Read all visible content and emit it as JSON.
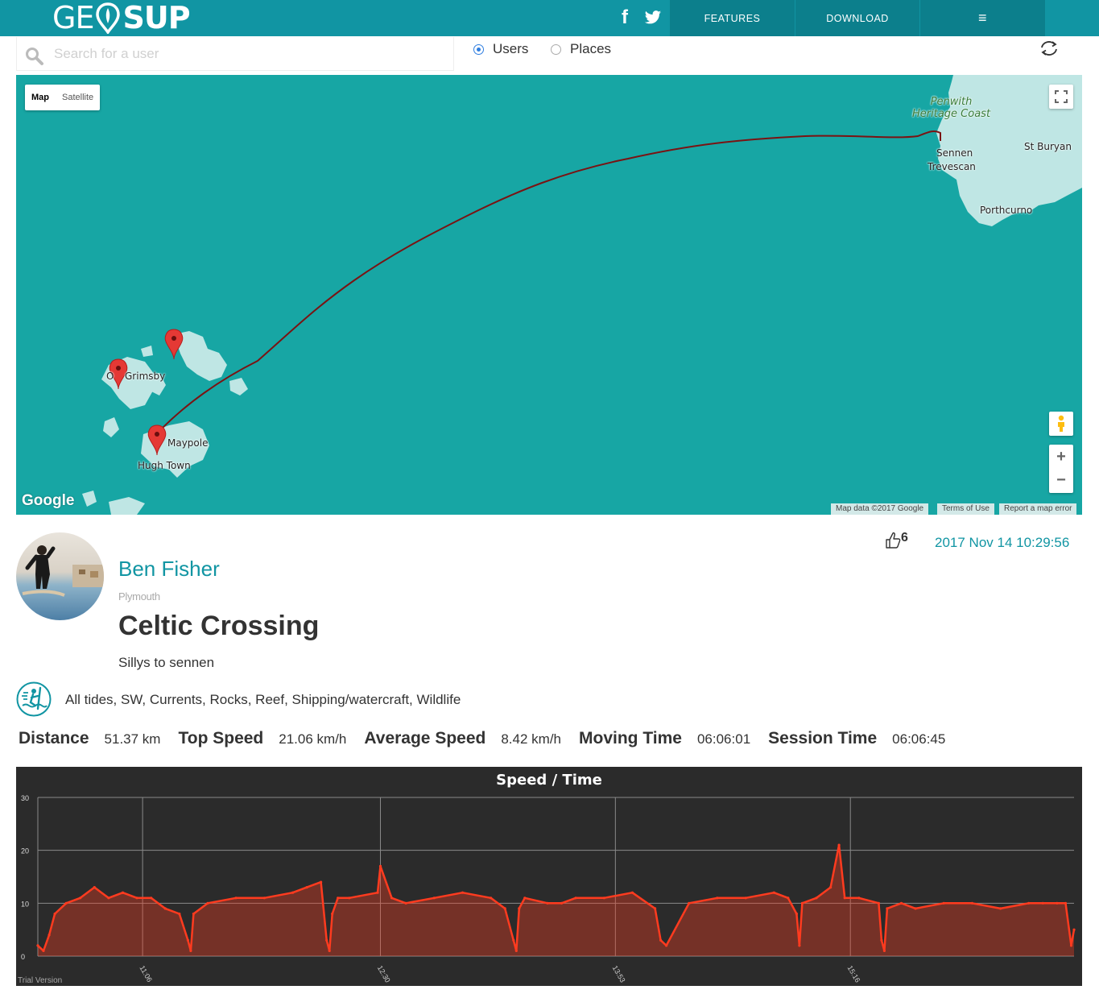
{
  "brand": {
    "logo_left": "GE",
    "logo_right": "SUP"
  },
  "nav": {
    "features": "FEATURES",
    "download": "DOWNLOAD",
    "menu": "≡",
    "facebook": "f"
  },
  "search": {
    "placeholder": "Search for a user",
    "value": ""
  },
  "filter": {
    "options": [
      "Users",
      "Places"
    ],
    "selected": "Users"
  },
  "map": {
    "type_buttons": [
      "Map",
      "Satellite"
    ],
    "selected_type": "Map",
    "labels": {
      "penwith": "Penwith\nHeritage Coast",
      "sennen": "Sennen",
      "trevescan": "Trevescan",
      "st_buryan": "St Buryan",
      "porthcurno": "Porthcurno",
      "grimsby": "Grimsby",
      "maypole": "Maypole",
      "hugh_town": "Hugh Town",
      "old_grimsby_prefix": "O"
    },
    "google_logo": "Google",
    "attribution": {
      "data": "Map data ©2017 Google",
      "terms": "Terms of Use",
      "report": "Report a map error"
    },
    "zoom_in": "+",
    "zoom_out": "−",
    "colors": {
      "water": "#17a6a4",
      "land": "#bfe6e4",
      "track": "#7a1313",
      "marker": "#e53935"
    }
  },
  "session": {
    "user_name": "Ben Fisher",
    "user_city": "Plymouth",
    "title": "Celtic Crossing",
    "description": "Sillys to sennen",
    "likes": "6",
    "date": "2017 Nov 14 10:29:56",
    "conditions": "All tides, SW, Currents, Rocks, Reef, Shipping/watercraft, Wildlife"
  },
  "stats": [
    {
      "label": "Distance",
      "value": "51.37 km"
    },
    {
      "label": "Top Speed",
      "value": "21.06 km/h"
    },
    {
      "label": "Average Speed",
      "value": "8.42 km/h"
    },
    {
      "label": "Moving Time",
      "value": "06:06:01"
    },
    {
      "label": "Session Time",
      "value": "06:06:45"
    }
  ],
  "chart_data": {
    "type": "area",
    "title": "Speed / Time",
    "watermark": "Trial Version",
    "ylim": [
      0,
      30
    ],
    "y_ticks": [
      0,
      10,
      20,
      30
    ],
    "x_tick_labels": [
      "11:06",
      "12:30",
      "13:53",
      "15:16"
    ],
    "x_range_minutes": [
      0,
      366
    ],
    "x_tick_minutes": [
      37,
      121,
      204,
      287
    ],
    "series": [
      {
        "color": "#ff3b1f",
        "t_minutes": [
          0,
          2,
          4,
          6,
          10,
          15,
          20,
          25,
          30,
          35,
          40,
          45,
          50,
          53,
          54,
          55,
          60,
          70,
          80,
          90,
          95,
          100,
          102,
          103,
          104,
          106,
          110,
          120,
          121,
          125,
          130,
          140,
          150,
          160,
          165,
          168,
          169,
          170,
          172,
          180,
          185,
          190,
          200,
          210,
          218,
          220,
          222,
          230,
          240,
          250,
          260,
          265,
          268,
          269,
          270,
          275,
          280,
          283,
          285,
          290,
          297,
          298,
          299,
          300,
          305,
          310,
          320,
          330,
          340,
          350,
          355,
          360,
          363,
          365,
          366
        ],
        "speed_kmh": [
          2,
          1,
          4,
          8,
          10,
          11,
          13,
          11,
          12,
          11,
          11,
          9,
          8,
          3,
          1,
          8,
          10,
          11,
          11,
          12,
          13,
          14,
          3,
          1,
          8,
          11,
          11,
          12,
          17,
          11,
          10,
          11,
          12,
          11,
          9,
          3,
          1,
          9,
          11,
          10,
          10,
          11,
          11,
          12,
          9,
          3,
          2,
          10,
          11,
          11,
          12,
          11,
          8,
          2,
          10,
          11,
          13,
          21,
          11,
          11,
          10,
          3,
          1,
          9,
          10,
          9,
          10,
          10,
          9,
          10,
          10,
          10,
          10,
          2,
          5
        ]
      }
    ]
  }
}
